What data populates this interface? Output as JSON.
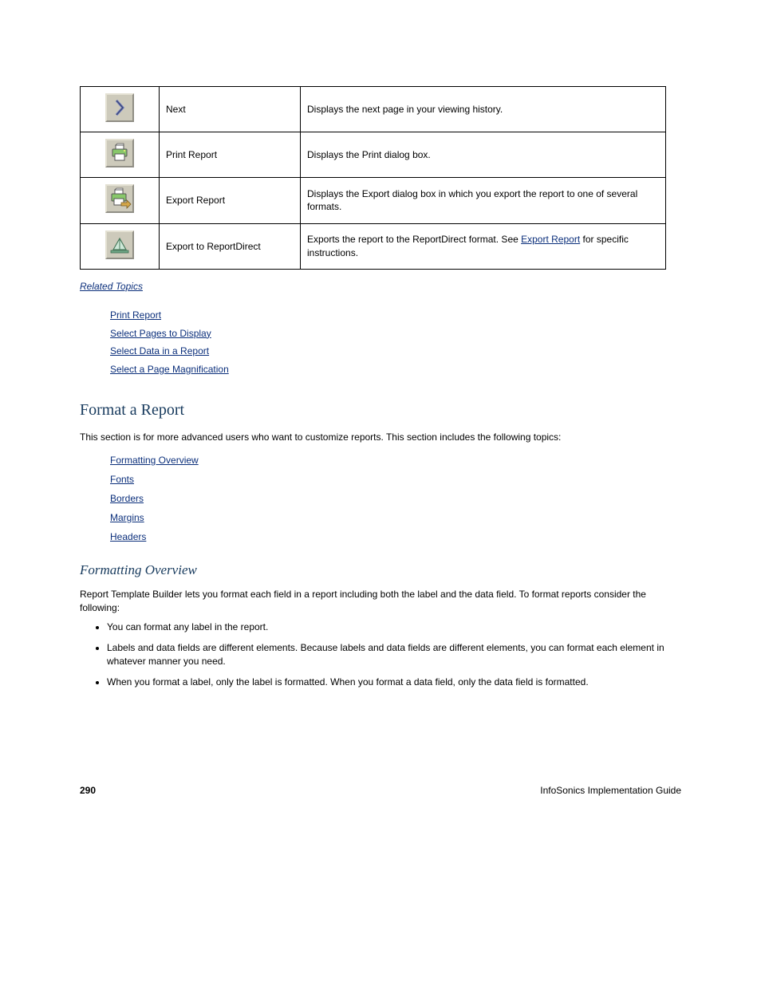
{
  "table": {
    "rows": [
      {
        "icon_name": "chevron-right-icon",
        "name": "Next",
        "desc": "Displays the next page in your viewing history."
      },
      {
        "icon_name": "printer-icon",
        "name": "Print Report",
        "desc": "Displays the Print dialog box."
      },
      {
        "icon_name": "printer-export-icon",
        "name": "Export Report",
        "desc": "Displays the Export dialog box in which you export the report to one of several formats."
      },
      {
        "icon_name": "export-report-icon",
        "name": "Export to ReportDirect",
        "desc_pre": "Exports the report to the ReportDirect format. See ",
        "desc_link": "Export Report",
        "desc_post": " for specific instructions."
      }
    ]
  },
  "related": {
    "heading": "Related Topics",
    "links": [
      "Print Report",
      "Select Pages to Display",
      "Select Data in a Report",
      "Select a Page Magnification"
    ]
  },
  "section_format": {
    "title": "Format a Report",
    "intro": "This section is for more advanced users who want to customize reports. This section includes the following topics:",
    "links": [
      "Formatting Overview",
      "Fonts",
      "Borders",
      "Margins",
      "Headers"
    ]
  },
  "section_overview": {
    "title": "Formatting Overview",
    "p1": "Report Template Builder lets you format each field in a report including both the label and the data field. To format reports consider the following:",
    "bullets": [
      "You can format any label in the report.",
      "Labels and data fields are different elements. Because labels and data fields are different elements, you can format each element in whatever manner you need.",
      "When you format a label, only the label is formatted. When you format a data field, only the data field is formatted."
    ]
  },
  "footer": {
    "page_number": "290",
    "doc_title": "InfoSonics Implementation Guide"
  }
}
